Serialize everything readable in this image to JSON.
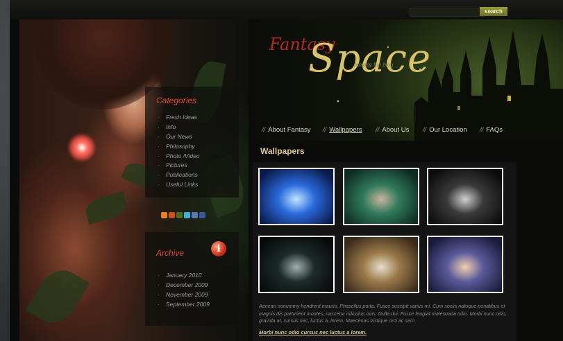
{
  "search": {
    "placeholder": "",
    "button_label": "search"
  },
  "logo": {
    "word1": "Fantasy",
    "word2": "Space",
    "tagline": "fantasy fun blog"
  },
  "nav": {
    "separator": "//",
    "items": [
      {
        "label": "About Fantasy",
        "active": false
      },
      {
        "label": "Wallpapers",
        "active": true
      },
      {
        "label": "About Us",
        "active": false
      },
      {
        "label": "Our Location",
        "active": false
      },
      {
        "label": "FAQs",
        "active": false
      }
    ]
  },
  "sidebar": {
    "categories_title": "Categories",
    "categories": [
      "Fresh Ideas",
      "Info",
      "Our News",
      "Philosophy",
      "Photo /Video",
      "Pictures",
      "Publications",
      "Useful Links"
    ],
    "archive_title": "Archive",
    "archive": [
      "January 2010",
      "December 2009",
      "November 2009",
      "September 2009"
    ],
    "social_icons": [
      "rss-icon",
      "feed-icon",
      "myspace-icon",
      "twitter-icon",
      "email-icon",
      "facebook-icon"
    ]
  },
  "main": {
    "section_title": "Wallpapers",
    "thumbnails": [
      {
        "name": "unicorn-moon-thumb",
        "colors": [
          "#0a1a4a",
          "#2a6adc",
          "#bfe4ff"
        ]
      },
      {
        "name": "fairy-bird-thumb",
        "colors": [
          "#0e2a22",
          "#2f7a5a",
          "#c9b3a0"
        ]
      },
      {
        "name": "dark-angel-thumb",
        "colors": [
          "#0c0c0c",
          "#3a3a3a",
          "#d0d0d0"
        ]
      },
      {
        "name": "dark-riders-thumb",
        "colors": [
          "#070a0a",
          "#1e2a2a",
          "#9fb0b0"
        ]
      },
      {
        "name": "warrior-woman-thumb",
        "colors": [
          "#3a2a1a",
          "#9a7a4a",
          "#e8ddcc"
        ]
      },
      {
        "name": "dragon-sunset-thumb",
        "colors": [
          "#1a1a3a",
          "#5a5a9a",
          "#f0d0b0"
        ]
      }
    ],
    "caption": "Aenean nonummy hendrerit mauris. Phasellus porta. Fusce suscipit varius mi. Cum sociis natoque penatibus et magnis dis parturient montes, nascetur ridiculus mus. Nulla dui. Fusce feugiat malesuada odio. Morbi nunc odio, gravida at, cursus nec, luctus a, lorem. Maecenas tristique orci ac sem.",
    "more_link": "Morbi nunc odio cursus nec luctus a lorem."
  },
  "colors": {
    "accent_red": "#e5472a",
    "gold": "#d7c36a",
    "nav_text": "#d9d9c8"
  }
}
